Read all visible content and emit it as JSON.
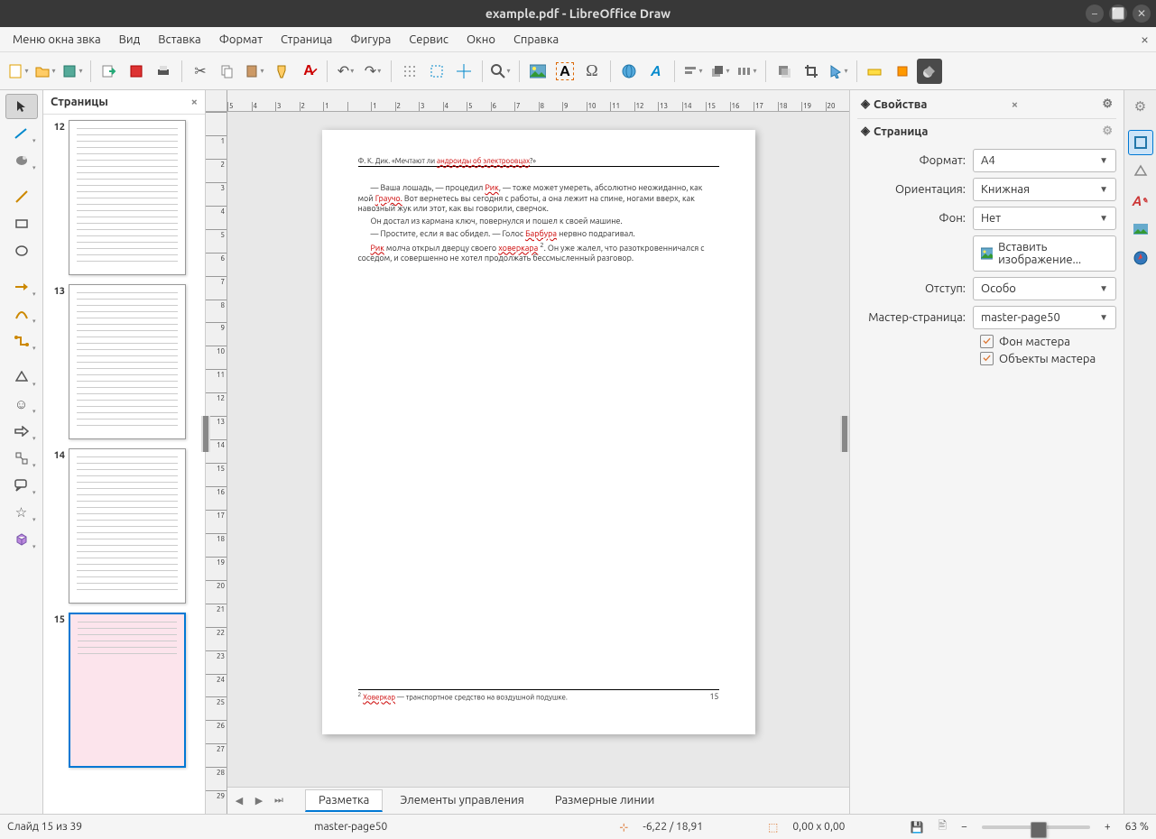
{
  "window": {
    "title": "example.pdf - LibreOffice Draw"
  },
  "menu": {
    "sound": "Меню окна звка",
    "items": [
      "Вид",
      "Вставка",
      "Формат",
      "Страница",
      "Фигура",
      "Сервис",
      "Окно",
      "Справка"
    ]
  },
  "pages_panel": {
    "title": "Страницы",
    "thumbs": [
      {
        "num": "12"
      },
      {
        "num": "13"
      },
      {
        "num": "14"
      },
      {
        "num": "15",
        "selected": true
      }
    ]
  },
  "ruler_h": [
    "5",
    "4",
    "3",
    "2",
    "1",
    "",
    "1",
    "2",
    "3",
    "4",
    "5",
    "6",
    "7",
    "8",
    "9",
    "10",
    "11",
    "12",
    "13",
    "14",
    "15",
    "16",
    "17",
    "18",
    "19",
    "20"
  ],
  "ruler_v": [
    "",
    "1",
    "2",
    "3",
    "4",
    "5",
    "6",
    "7",
    "8",
    "9",
    "10",
    "11",
    "12",
    "13",
    "14",
    "15",
    "16",
    "17",
    "18",
    "19",
    "20",
    "21",
    "22",
    "23",
    "24",
    "25",
    "26",
    "27",
    "28",
    "29"
  ],
  "page_content": {
    "header": {
      "prefix": "Ф. К. Дик.  «Мечтают ли ",
      "red": "андроиды об электроовцах",
      "suffix": "?»"
    },
    "p1_a": "— Ваша лошадь, — процедил ",
    "p1_red1": "Рик",
    "p1_b": ", — тоже может умереть, абсолютно неожиданно, как мой ",
    "p1_red2": "Граучо.",
    "p1_c": " Вот вернетесь вы сегодня с работы, а она лежит на спине, ногами вверх, как навозный жук или этот, как вы говорили, сверчок.",
    "p2": "Он достал из кармана ключ, повернулся и пошел к своей машине.",
    "p3_a": "— Простите, если я вас обидел. — Голос ",
    "p3_red": "Барбура",
    "p3_b": " нервно подрагивал.",
    "p4_red1": "Рик",
    "p4_a": " молча открыл дверцу своего ",
    "p4_red2": "ховеркара",
    "p4_sup": "2",
    "p4_b": ". Он уже жалел, что разоткровенничался с соседом, и совершенно не хотел продолжать бессмысленный разговор.",
    "footnote_sup": "2",
    "footnote_red": "Ховеркар",
    "footnote_text": " — транспортное средство на воздушной подушке.",
    "page_number": "15"
  },
  "tabs": {
    "layout": "Разметка",
    "controls": "Элементы управления",
    "dimensions": "Размерные линии"
  },
  "props": {
    "title": "Свойства",
    "section": "Страница",
    "format_label": "Формат:",
    "format_value": "A4",
    "orient_label": "Ориентация:",
    "orient_value": "Книжная",
    "bg_label": "Фон:",
    "bg_value": "Нет",
    "insert_image": "Вставить изображение...",
    "margin_label": "Отступ:",
    "margin_value": "Особо",
    "master_label": "Мастер-страница:",
    "master_value": "master-page50",
    "chk1": "Фон мастера",
    "chk2": "Объекты мастера"
  },
  "status": {
    "slide": "Слайд 15 из 39",
    "master": "master-page50",
    "coords": "-6,22 / 18,91",
    "size": "0,00 x 0,00",
    "zoom": "63 %"
  }
}
